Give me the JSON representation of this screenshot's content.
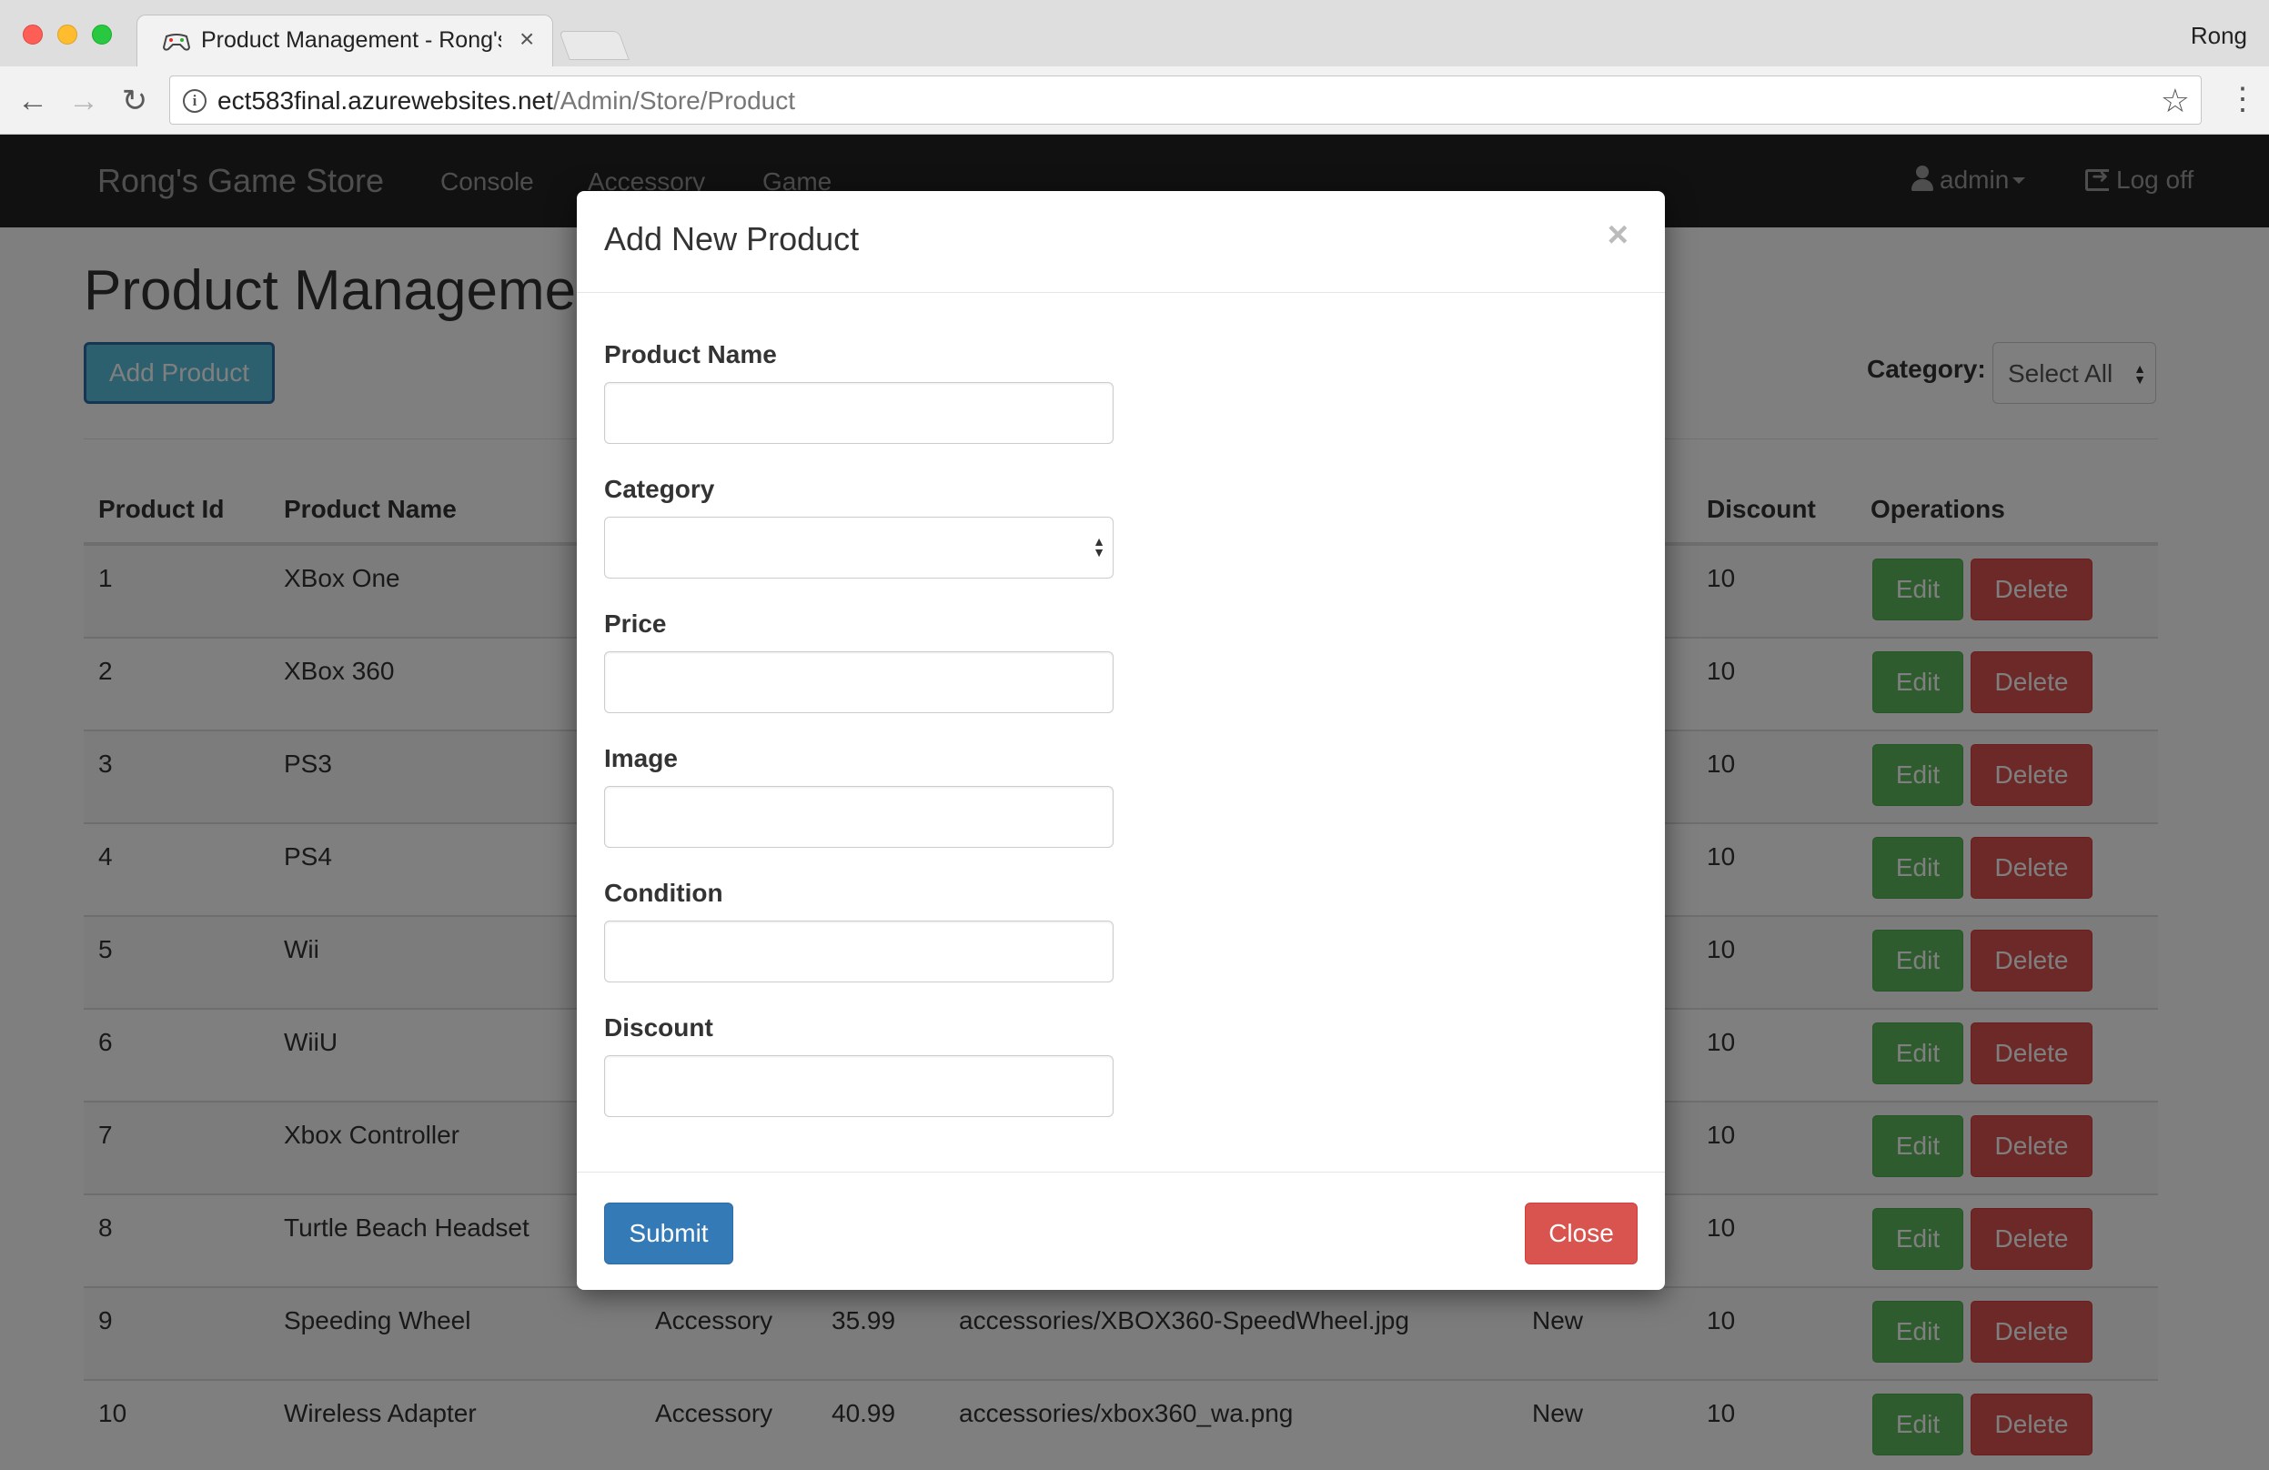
{
  "browser": {
    "tab_title": "Product Management - Rong's Game Store",
    "profile_name": "Rong",
    "url_host": "ect583final.azurewebsites.net",
    "url_path": "/Admin/Store/Product"
  },
  "site": {
    "brand": "Rong's Game Store",
    "nav": [
      "Console",
      "Accessory",
      "Game"
    ],
    "user_label": "admin",
    "logoff_label": "Log off"
  },
  "page": {
    "title": "Product Management",
    "add_button": "Add Product",
    "category_label": "Category:",
    "category_value": "Select All"
  },
  "table": {
    "headers": [
      "Product Id",
      "Product Name",
      "Discount",
      "Operations"
    ],
    "edit_label": "Edit",
    "delete_label": "Delete",
    "rows": [
      {
        "id": "1",
        "name": "XBox One",
        "category": "",
        "price": "",
        "image": "",
        "condition": "",
        "discount": "10"
      },
      {
        "id": "2",
        "name": "XBox 360",
        "category": "",
        "price": "",
        "image": "",
        "condition": "",
        "discount": "10"
      },
      {
        "id": "3",
        "name": "PS3",
        "category": "",
        "price": "",
        "image": "",
        "condition": "",
        "discount": "10"
      },
      {
        "id": "4",
        "name": "PS4",
        "category": "",
        "price": "",
        "image": "",
        "condition": "",
        "discount": "10"
      },
      {
        "id": "5",
        "name": "Wii",
        "category": "",
        "price": "",
        "image": "",
        "condition": "",
        "discount": "10"
      },
      {
        "id": "6",
        "name": "WiiU",
        "category": "",
        "price": "",
        "image": "",
        "condition": "",
        "discount": "10"
      },
      {
        "id": "7",
        "name": "Xbox Controller",
        "category": "",
        "price": "",
        "image": "",
        "condition": "",
        "discount": "10"
      },
      {
        "id": "8",
        "name": "Turtle Beach Headset",
        "category": "",
        "price": "",
        "image": "",
        "condition": "",
        "discount": "10"
      },
      {
        "id": "9",
        "name": "Speeding Wheel",
        "category": "Accessory",
        "price": "35.99",
        "image": "accessories/XBOX360-SpeedWheel.jpg",
        "condition": "New",
        "discount": "10"
      },
      {
        "id": "10",
        "name": "Wireless Adapter",
        "category": "Accessory",
        "price": "40.99",
        "image": "accessories/xbox360_wa.png",
        "condition": "New",
        "discount": "10"
      }
    ]
  },
  "modal": {
    "title": "Add New Product",
    "close_glyph": "×",
    "fields": {
      "product_name": {
        "label": "Product Name",
        "value": ""
      },
      "category": {
        "label": "Category",
        "value": ""
      },
      "price": {
        "label": "Price",
        "value": ""
      },
      "image": {
        "label": "Image",
        "value": ""
      },
      "condition": {
        "label": "Condition",
        "value": ""
      },
      "discount": {
        "label": "Discount",
        "value": ""
      }
    },
    "submit_label": "Submit",
    "close_label": "Close"
  },
  "colors": {
    "navbar": "#222222",
    "info_button": "#5bc0de",
    "primary": "#337ab7",
    "success": "#5cb85c",
    "danger": "#d9534f"
  },
  "icons": [
    "back-arrow-icon",
    "forward-arrow-icon",
    "reload-icon",
    "info-icon",
    "star-icon",
    "kebab-menu-icon",
    "user-icon",
    "logoff-icon",
    "close-icon",
    "select-updown-icon"
  ]
}
